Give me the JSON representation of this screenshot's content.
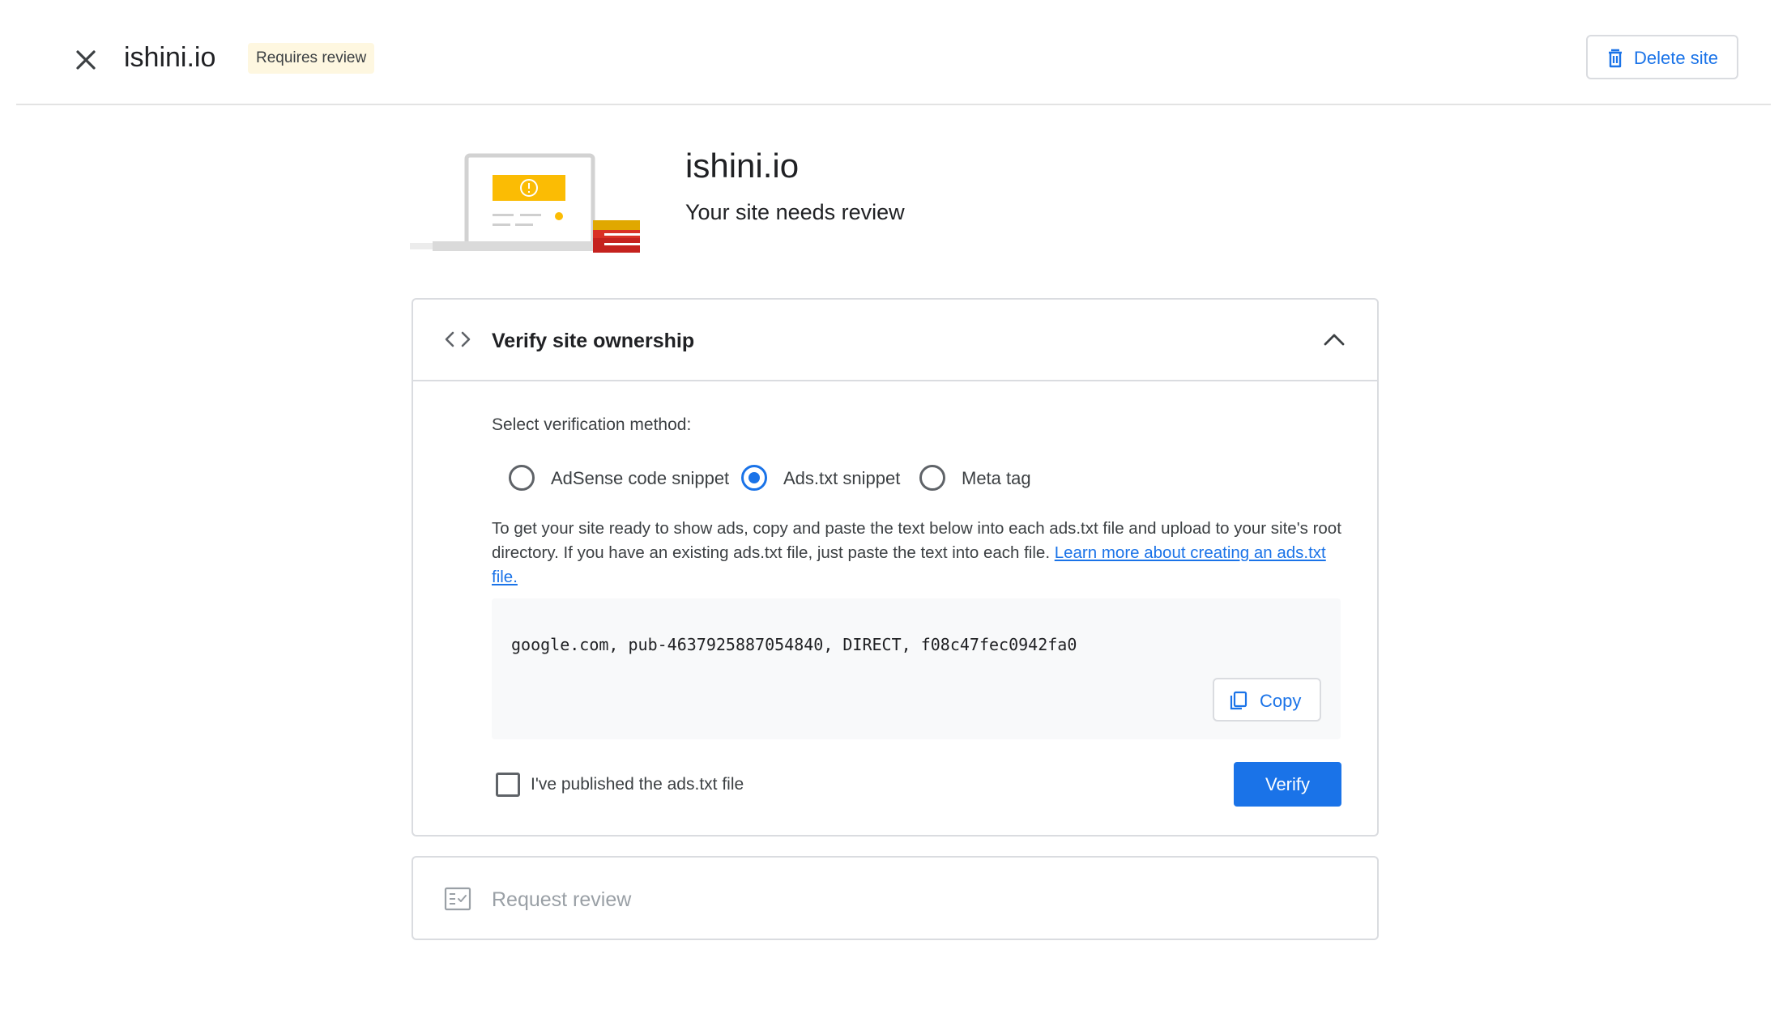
{
  "header": {
    "title": "ishini.io",
    "status_chip": "Requires review",
    "delete_label": "Delete site"
  },
  "hero": {
    "title": "ishini.io",
    "subtitle": "Your site needs review"
  },
  "verify_card": {
    "title": "Verify site ownership",
    "method_label": "Select verification method:",
    "methods": [
      {
        "label": "AdSense code snippet",
        "selected": false
      },
      {
        "label": "Ads.txt snippet",
        "selected": true
      },
      {
        "label": "Meta tag",
        "selected": false
      }
    ],
    "instructions": "To get your site ready to show ads, copy and paste the text below into each ads.txt file and upload to your site's root directory. If you have an existing ads.txt file, just paste the text into each file.",
    "learn_more_link": "Learn more about creating an ads.txt file.",
    "snippet": "google.com, pub-4637925887054840, DIRECT, f08c47fec0942fa0",
    "copy_label": "Copy",
    "checkbox_label": "I've published the ads.txt file",
    "checkbox_checked": false,
    "verify_label": "Verify"
  },
  "review_card": {
    "title": "Request review"
  },
  "colors": {
    "accent": "#1a73e8",
    "chip_bg": "#fef7e0",
    "border": "#dadce0",
    "snippet_bg": "#f8f9fa",
    "disabled_text": "#9aa0a6"
  },
  "icons": {
    "close": "close-icon",
    "delete": "trash-icon",
    "code": "code-brackets-icon",
    "collapse": "chevron-up-icon",
    "copy": "copy-icon",
    "review": "checklist-icon"
  }
}
